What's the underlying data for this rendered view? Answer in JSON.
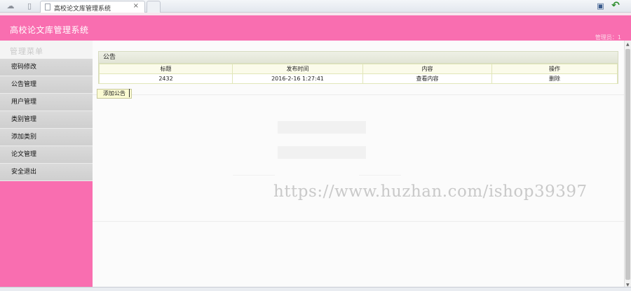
{
  "browser": {
    "tab_title": "高校论文库管理系统",
    "tab_close": "×",
    "icons": [
      "cloud-icon",
      "sidebar-icon",
      "page-icon",
      "new-tab-icon",
      "translate-icon",
      "back-arrow-icon"
    ]
  },
  "header": {
    "site_title": "高校论文库管理系统",
    "user_info": "管理员：1"
  },
  "sidebar": {
    "menu_title": "管理菜单",
    "items": [
      {
        "label": "密码修改"
      },
      {
        "label": "公告管理"
      },
      {
        "label": "用户管理"
      },
      {
        "label": "类别管理"
      },
      {
        "label": "添加类别"
      },
      {
        "label": "论文管理"
      },
      {
        "label": "安全退出"
      }
    ]
  },
  "main": {
    "panel_title": "公告",
    "columns": [
      "标题",
      "发布时间",
      "内容",
      "操作"
    ],
    "rows": [
      {
        "title": "2432",
        "time": "2016-2-16 1:27:41",
        "content_link": "查看内容",
        "action_link": "删除"
      }
    ],
    "add_button": "添加公告"
  },
  "watermark": "https://www.huzhan.com/ishop39397",
  "colors": {
    "accent_pink": "#f96eb0",
    "sidebar_item_bg": "#d6d6d6",
    "table_border": "#e1e6b9"
  }
}
